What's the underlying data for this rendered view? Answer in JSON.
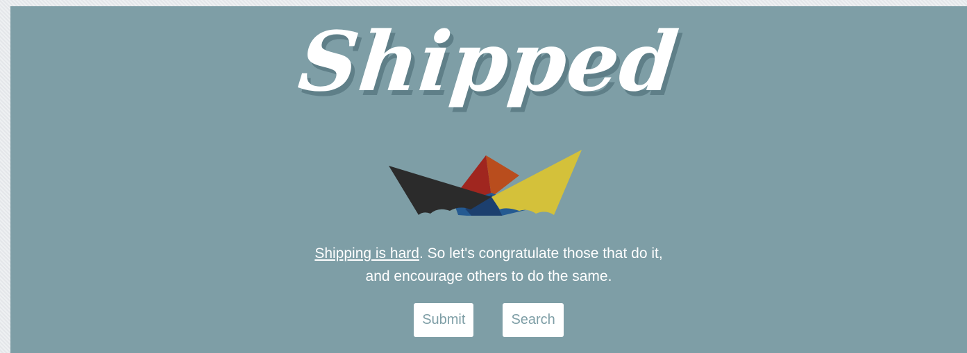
{
  "logo": {
    "text": "Shipped"
  },
  "boat_icon": {
    "name": "paper-boat-icon",
    "colors": {
      "black": "#2b2b2b",
      "red": "#a0261f",
      "orange": "#b94d1d",
      "yellow": "#d4c13a",
      "blue": "#255a91",
      "dark_blue": "#1c3f6e"
    }
  },
  "tagline": {
    "link_text": "Shipping is hard",
    "line1_rest": ". So let's congratulate those that do it,",
    "line2": "and encourage others to do the same."
  },
  "actions": {
    "submit_label": "Submit",
    "search_label": "Search"
  },
  "colors": {
    "hero_background": "#7e9ea6",
    "page_background": "#e8ebee",
    "button_text": "#7e9ea6",
    "button_background": "#ffffff"
  }
}
